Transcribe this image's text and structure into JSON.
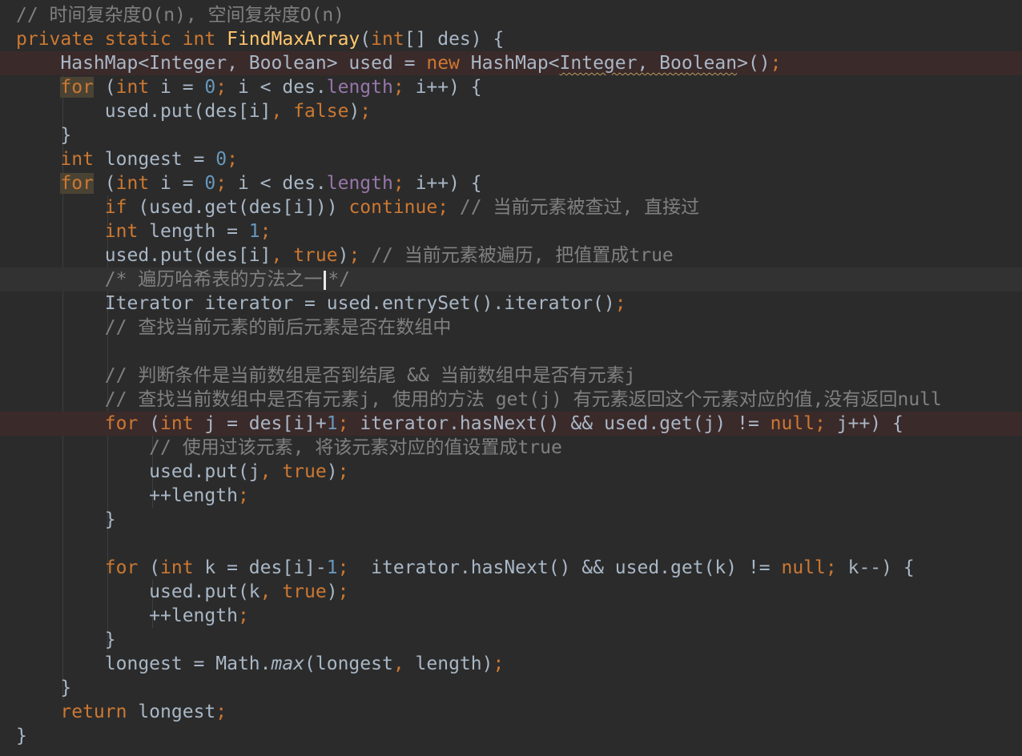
{
  "editor": {
    "language": "Java",
    "theme": "Darcula",
    "caret_line": 12,
    "lines": [
      [
        {
          "t": "// 时间复杂度O(n), 空间复杂度O(n)",
          "c": "comment"
        }
      ],
      [
        {
          "t": "private static int ",
          "c": "kw"
        },
        {
          "t": "FindMaxArray",
          "c": "method"
        },
        {
          "t": "(",
          "c": ""
        },
        {
          "t": "int",
          "c": "kw"
        },
        {
          "t": "[] des) {",
          "c": ""
        }
      ],
      [
        {
          "t": "    HashMap<Integer, Boolean> used = ",
          "c": ""
        },
        {
          "t": "new ",
          "c": "kw"
        },
        {
          "t": "HashMap<",
          "c": ""
        },
        {
          "t": "Integer, Boolean",
          "c": "squiggle"
        },
        {
          "t": ">()",
          "c": ""
        },
        {
          "t": ";",
          "c": "kw"
        }
      ],
      [
        {
          "t": "    ",
          "c": ""
        },
        {
          "t": "for",
          "c": "kw highlight"
        },
        {
          "t": " (",
          "c": ""
        },
        {
          "t": "int ",
          "c": "kw"
        },
        {
          "t": "i = ",
          "c": ""
        },
        {
          "t": "0",
          "c": "num"
        },
        {
          "t": "; ",
          "c": "kw"
        },
        {
          "t": "i < des.",
          "c": ""
        },
        {
          "t": "length",
          "c": "field"
        },
        {
          "t": "; ",
          "c": "kw"
        },
        {
          "t": "i++) {",
          "c": ""
        }
      ],
      [
        {
          "t": "        used.put(des[i]",
          "c": ""
        },
        {
          "t": ", false",
          "c": "kw"
        },
        {
          "t": ")",
          "c": ""
        },
        {
          "t": ";",
          "c": "kw"
        }
      ],
      [
        {
          "t": "    }",
          "c": ""
        }
      ],
      [
        {
          "t": "    ",
          "c": ""
        },
        {
          "t": "int ",
          "c": "kw"
        },
        {
          "t": "longest = ",
          "c": ""
        },
        {
          "t": "0",
          "c": "num"
        },
        {
          "t": ";",
          "c": "kw"
        }
      ],
      [
        {
          "t": "    ",
          "c": ""
        },
        {
          "t": "for",
          "c": "kw highlight"
        },
        {
          "t": " (",
          "c": ""
        },
        {
          "t": "int ",
          "c": "kw"
        },
        {
          "t": "i = ",
          "c": ""
        },
        {
          "t": "0",
          "c": "num"
        },
        {
          "t": "; ",
          "c": "kw"
        },
        {
          "t": "i < des.",
          "c": ""
        },
        {
          "t": "length",
          "c": "field"
        },
        {
          "t": "; ",
          "c": "kw"
        },
        {
          "t": "i++) {",
          "c": ""
        }
      ],
      [
        {
          "t": "        ",
          "c": ""
        },
        {
          "t": "if ",
          "c": "kw"
        },
        {
          "t": "(used.get(des[i])) ",
          "c": ""
        },
        {
          "t": "continue;",
          "c": "kw"
        },
        {
          "t": " // 当前元素被查过, 直接过",
          "c": "comment"
        }
      ],
      [
        {
          "t": "        ",
          "c": ""
        },
        {
          "t": "int ",
          "c": "kw"
        },
        {
          "t": "length = ",
          "c": ""
        },
        {
          "t": "1",
          "c": "num"
        },
        {
          "t": ";",
          "c": "kw"
        }
      ],
      [
        {
          "t": "        used.put(des[i]",
          "c": ""
        },
        {
          "t": ", true",
          "c": "kw"
        },
        {
          "t": ")",
          "c": ""
        },
        {
          "t": ";",
          "c": "kw"
        },
        {
          "t": " // 当前元素被遍历, 把值置成true",
          "c": "comment"
        }
      ],
      [
        {
          "t": "        /* 遍历哈希表的方法之一",
          "c": "comment"
        },
        {
          "t": "",
          "c": "caret"
        },
        {
          "t": "*/",
          "c": "comment"
        }
      ],
      [
        {
          "t": "        Iterator iterator = used.entrySet().iterator()",
          "c": ""
        },
        {
          "t": ";",
          "c": "kw"
        }
      ],
      [
        {
          "t": "        // 查找当前元素的前后元素是否在数组中",
          "c": "comment"
        }
      ],
      [],
      [
        {
          "t": "        // 判断条件是当前数组是否到结尾 && 当前数组中是否有元素j",
          "c": "comment"
        }
      ],
      [
        {
          "t": "        // 查找当前数组中是否有元素j, 使用的方法 get(j) 有元素返回这个元素对应的值,没有返回null",
          "c": "comment"
        }
      ],
      [
        {
          "t": "        ",
          "c": ""
        },
        {
          "t": "for ",
          "c": "kw"
        },
        {
          "t": "(",
          "c": ""
        },
        {
          "t": "int ",
          "c": "kw"
        },
        {
          "t": "j = des[i]+",
          "c": ""
        },
        {
          "t": "1",
          "c": "num"
        },
        {
          "t": "; ",
          "c": "kw"
        },
        {
          "t": "iterator.hasNext() && used.get(j) != ",
          "c": ""
        },
        {
          "t": "null",
          "c": "kw"
        },
        {
          "t": "; ",
          "c": "kw"
        },
        {
          "t": "j++) {",
          "c": ""
        }
      ],
      [
        {
          "t": "            // 使用过该元素, 将该元素对应的值设置成true",
          "c": "comment"
        }
      ],
      [
        {
          "t": "            used.put(j",
          "c": ""
        },
        {
          "t": ", true",
          "c": "kw"
        },
        {
          "t": ")",
          "c": ""
        },
        {
          "t": ";",
          "c": "kw"
        }
      ],
      [
        {
          "t": "            ++length",
          "c": ""
        },
        {
          "t": ";",
          "c": "kw"
        }
      ],
      [
        {
          "t": "        }",
          "c": ""
        }
      ],
      [],
      [
        {
          "t": "        ",
          "c": ""
        },
        {
          "t": "for ",
          "c": "kw"
        },
        {
          "t": "(",
          "c": ""
        },
        {
          "t": "int ",
          "c": "kw"
        },
        {
          "t": "k = des[i]-",
          "c": ""
        },
        {
          "t": "1",
          "c": "num"
        },
        {
          "t": ";  ",
          "c": "kw"
        },
        {
          "t": "iterator.hasNext() && used.get(k) != ",
          "c": ""
        },
        {
          "t": "null",
          "c": "kw"
        },
        {
          "t": "; ",
          "c": "kw"
        },
        {
          "t": "k--) {",
          "c": ""
        }
      ],
      [
        {
          "t": "            used.put(k",
          "c": ""
        },
        {
          "t": ", true",
          "c": "kw"
        },
        {
          "t": ")",
          "c": ""
        },
        {
          "t": ";",
          "c": "kw"
        }
      ],
      [
        {
          "t": "            ++length",
          "c": ""
        },
        {
          "t": ";",
          "c": "kw"
        }
      ],
      [
        {
          "t": "        }",
          "c": ""
        }
      ],
      [
        {
          "t": "        longest = Math.",
          "c": ""
        },
        {
          "t": "max",
          "c": "italic"
        },
        {
          "t": "(longest",
          "c": ""
        },
        {
          "t": ", ",
          "c": "kw"
        },
        {
          "t": "length)",
          "c": ""
        },
        {
          "t": ";",
          "c": "kw"
        }
      ],
      [
        {
          "t": "    }",
          "c": ""
        }
      ],
      [
        {
          "t": "    ",
          "c": ""
        },
        {
          "t": "return ",
          "c": "kw"
        },
        {
          "t": "longest",
          "c": ""
        },
        {
          "t": ";",
          "c": "kw"
        }
      ],
      [
        {
          "t": "}",
          "c": ""
        }
      ]
    ]
  },
  "colors": {
    "background": "#2b2b2b",
    "plain": "#a9b7c6",
    "keyword": "#cc7832",
    "number": "#6897bb",
    "field": "#9876aa",
    "method": "#ffc66d",
    "comment": "#808080",
    "error_line": "#3b2a2a",
    "caret_line": "#323232"
  }
}
